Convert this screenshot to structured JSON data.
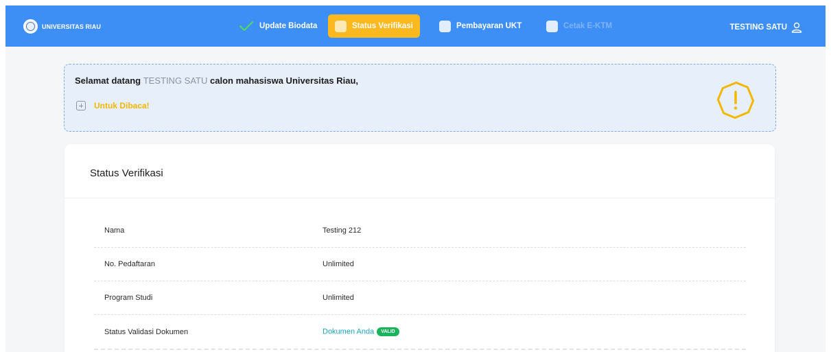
{
  "navbar": {
    "brand": "UNIVERSITAS RIAU",
    "items": [
      {
        "label": "Update Biodata",
        "state": "done"
      },
      {
        "label": "Status Verifikasi",
        "state": "active"
      },
      {
        "label": "Pembayaran UKT",
        "state": "default"
      },
      {
        "label": "Cetak E-KTM",
        "state": "disabled"
      }
    ],
    "user": "TESTING SATU",
    "colors": {
      "bar": "#3d8ff5",
      "active": "#fbb81f",
      "check": "#4cd964"
    }
  },
  "notice": {
    "greeting_prefix": "Selamat datang",
    "name": "TESTING SATU",
    "greeting_suffix": "calon mahasiswa Universitas Riau,",
    "toggle_label": "Untuk Dibaca!",
    "icon": "warning-hexagon-icon"
  },
  "card": {
    "title": "Status Verifikasi",
    "rows": [
      {
        "label": "Nama",
        "value": "Testing 212"
      },
      {
        "label": "No. Pedaftaran",
        "value": "Unlimited"
      },
      {
        "label": "Program Studi",
        "value": "Unlimited"
      },
      {
        "label": "Status Validasi Dokumen",
        "value": "Dokumen Anda",
        "badge": "VALID"
      }
    ]
  }
}
